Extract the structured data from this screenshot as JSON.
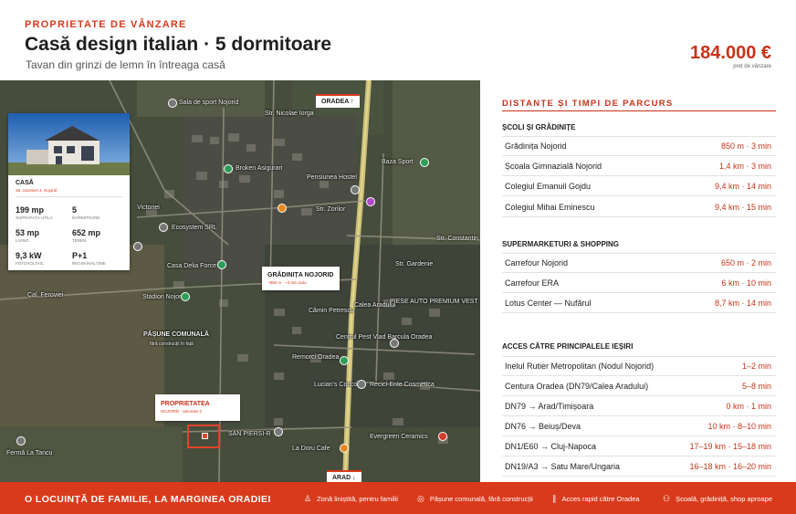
{
  "header": {
    "eyebrow": "PROPRIETATE DE VÂNZARE",
    "title": "Casă design italian · 5 dormitoare",
    "subtitle": "Tavan din grinzi de lemn în întreaga casă",
    "price": "184.000 €",
    "price_note": "preț de vânzare"
  },
  "map": {
    "north_label": "ORADEA ↑",
    "south_label": "ARAD ↓",
    "pois": [
      "Sala de sport Nojorid",
      "Str. Nicolae Iorga",
      "Broken Asigurari",
      "Pensiunea Hostel",
      "Baza Sport",
      "Str. Zorilor",
      "Str. Constantin",
      "Victoriei",
      "Ecosystem SRL",
      "Casa Delia Force",
      "Stadion Nojorid",
      "Cal. Feroviei",
      "Calea Aradului",
      "Cămin Petrescu",
      "PIESE AUTO PREMIUM VEST",
      "Centrul Pest Vlad Barcula Oradea",
      "Remorci Oradea",
      "Lucian's Coccono",
      "Recicl-Ente Cosmetica",
      "SAN PIERSI-R",
      "Evergreen Ceramics",
      "La Doru Cafe",
      "Fermă La Tancu",
      "Str. Gardenie"
    ],
    "pasture": {
      "title": "PĂȘUNE COMUNALĂ",
      "sub": "fără construcții în față"
    },
    "kindergarten": {
      "title": "GRĂDINIȚA NOJORID",
      "sub": "~850 m · ~3 min auto"
    },
    "property": {
      "title": "PROPRIETATEA",
      "sub": "NOJORID · Iasomiei 3"
    }
  },
  "house_card": {
    "label": "CASĂ",
    "address": "Str. Iasomiei 3, Nojorid",
    "stats": [
      {
        "value": "199 mp",
        "label": "SUPRAFAȚĂ UTILĂ"
      },
      {
        "value": "5",
        "label": "DORMITOARE"
      },
      {
        "value": "53 mp",
        "label": "LIVING"
      },
      {
        "value": "652 mp",
        "label": "TEREN"
      },
      {
        "value": "9,3 kW",
        "label": "FOTOVOLTAIC"
      },
      {
        "value": "P+1",
        "label": "REGIM ÎNĂLȚIME"
      }
    ]
  },
  "panel": {
    "title": "DISTANȚE ȘI TIMPI DE PARCURS",
    "sections": [
      {
        "heading": "ȘCOLI ȘI GRĂDINIȚE",
        "rows": [
          {
            "name": "Grădinița Nojorid",
            "dist": "850 m · 3 min"
          },
          {
            "name": "Școala Gimnazială Nojorid",
            "dist": "1,4 km · 3 min"
          },
          {
            "name": "Colegiul Emanuil Gojdu",
            "dist": "9,4 km · 14 min"
          },
          {
            "name": "Colegiul Mihai Eminescu",
            "dist": "9,4 km · 15 min"
          }
        ]
      },
      {
        "heading": "SUPERMARKETURI & SHOPPING",
        "rows": [
          {
            "name": "Carrefour Nojorid",
            "dist": "650 m · 2 min"
          },
          {
            "name": "Carrefour ERA",
            "dist": "6 km · 10 min"
          },
          {
            "name": "Lotus Center — Nufărul",
            "dist": "8,7 km · 14 min"
          }
        ]
      },
      {
        "heading": "ACCES CĂTRE PRINCIPALELE IEȘIRI",
        "rows": [
          {
            "name": "Inelul Rutier Metropolitan (Nodul Nojorid)",
            "dist": "1–2 min"
          },
          {
            "name": "Centura Oradea (DN79/Calea Aradului)",
            "dist": "5–8 min"
          },
          {
            "name": "DN79 → Arad/Timișoara",
            "dist": "0 km · 1 min"
          },
          {
            "name": "DN76 → Beiuș/Deva",
            "dist": "10 km · 8–10 min"
          },
          {
            "name": "DN1/E60 → Cluj-Napoca",
            "dist": "17–19 km · 15–18 min"
          },
          {
            "name": "DN19/A3 → Satu Mare/Ungaria",
            "dist": "16–18 km · 16–20 min"
          }
        ]
      }
    ]
  },
  "footer": {
    "title": "O LOCUINȚĂ DE FAMILIE, LA MARGINEA ORADIEI",
    "items": [
      {
        "icon": "person-icon",
        "label": "Zonă liniștită, pentru familii"
      },
      {
        "icon": "location-pin-icon",
        "label": "Pășune comunală, fără construcții"
      },
      {
        "icon": "road-icon",
        "label": "Acces rapid către Oradea"
      },
      {
        "icon": "family-icon",
        "label": "Școală, grădiniță, shop aproape"
      }
    ]
  },
  "colors": {
    "accent": "#d93a1c",
    "price": "#c9321a",
    "footer_bg": "#d93a1c"
  }
}
